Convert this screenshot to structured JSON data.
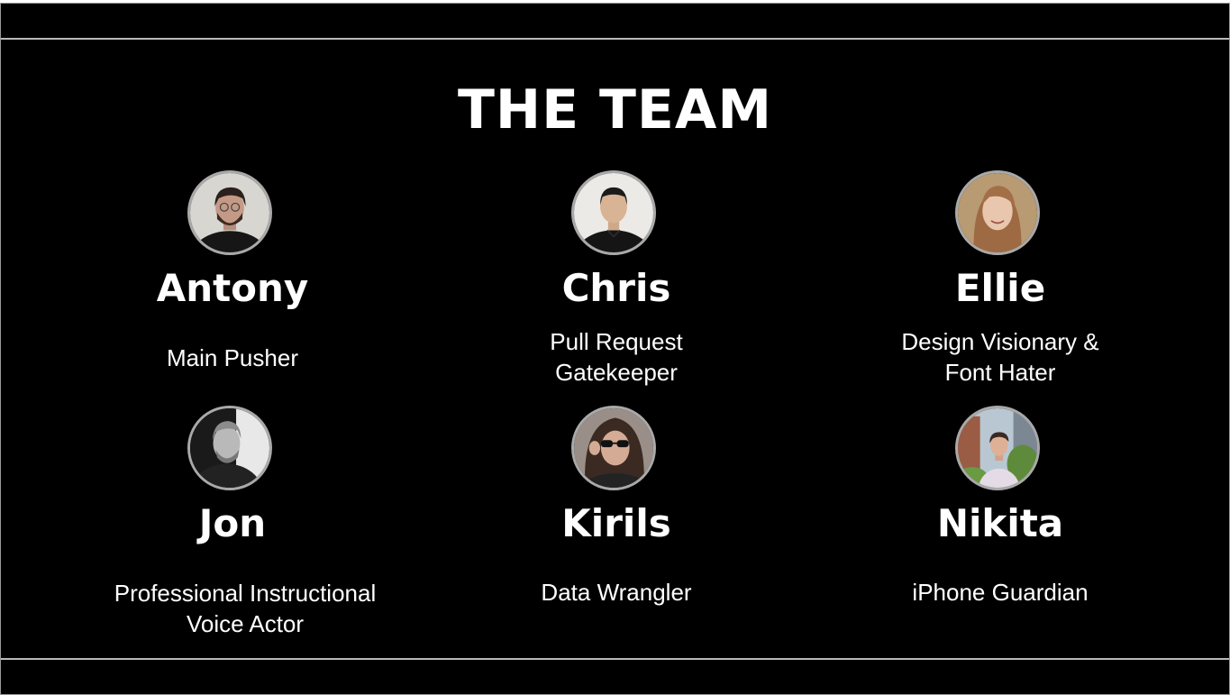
{
  "slide": {
    "title": "THE TEAM"
  },
  "members": [
    {
      "name": "Antony",
      "role": "Main Pusher"
    },
    {
      "name": "Chris",
      "role": "Pull Request\nGatekeeper"
    },
    {
      "name": "Ellie",
      "role": "Design Visionary &\nFont Hater"
    },
    {
      "name": "Jon",
      "role": "Professional Instructional\nVoice Actor"
    },
    {
      "name": "Kirils",
      "role": "Data Wrangler"
    },
    {
      "name": "Nikita",
      "role": "iPhone Guardian"
    }
  ],
  "colors": {
    "background": "#000000",
    "text": "#ffffff",
    "rule": "#b9b9b9",
    "avatar_ring": "#a9a9a9"
  }
}
